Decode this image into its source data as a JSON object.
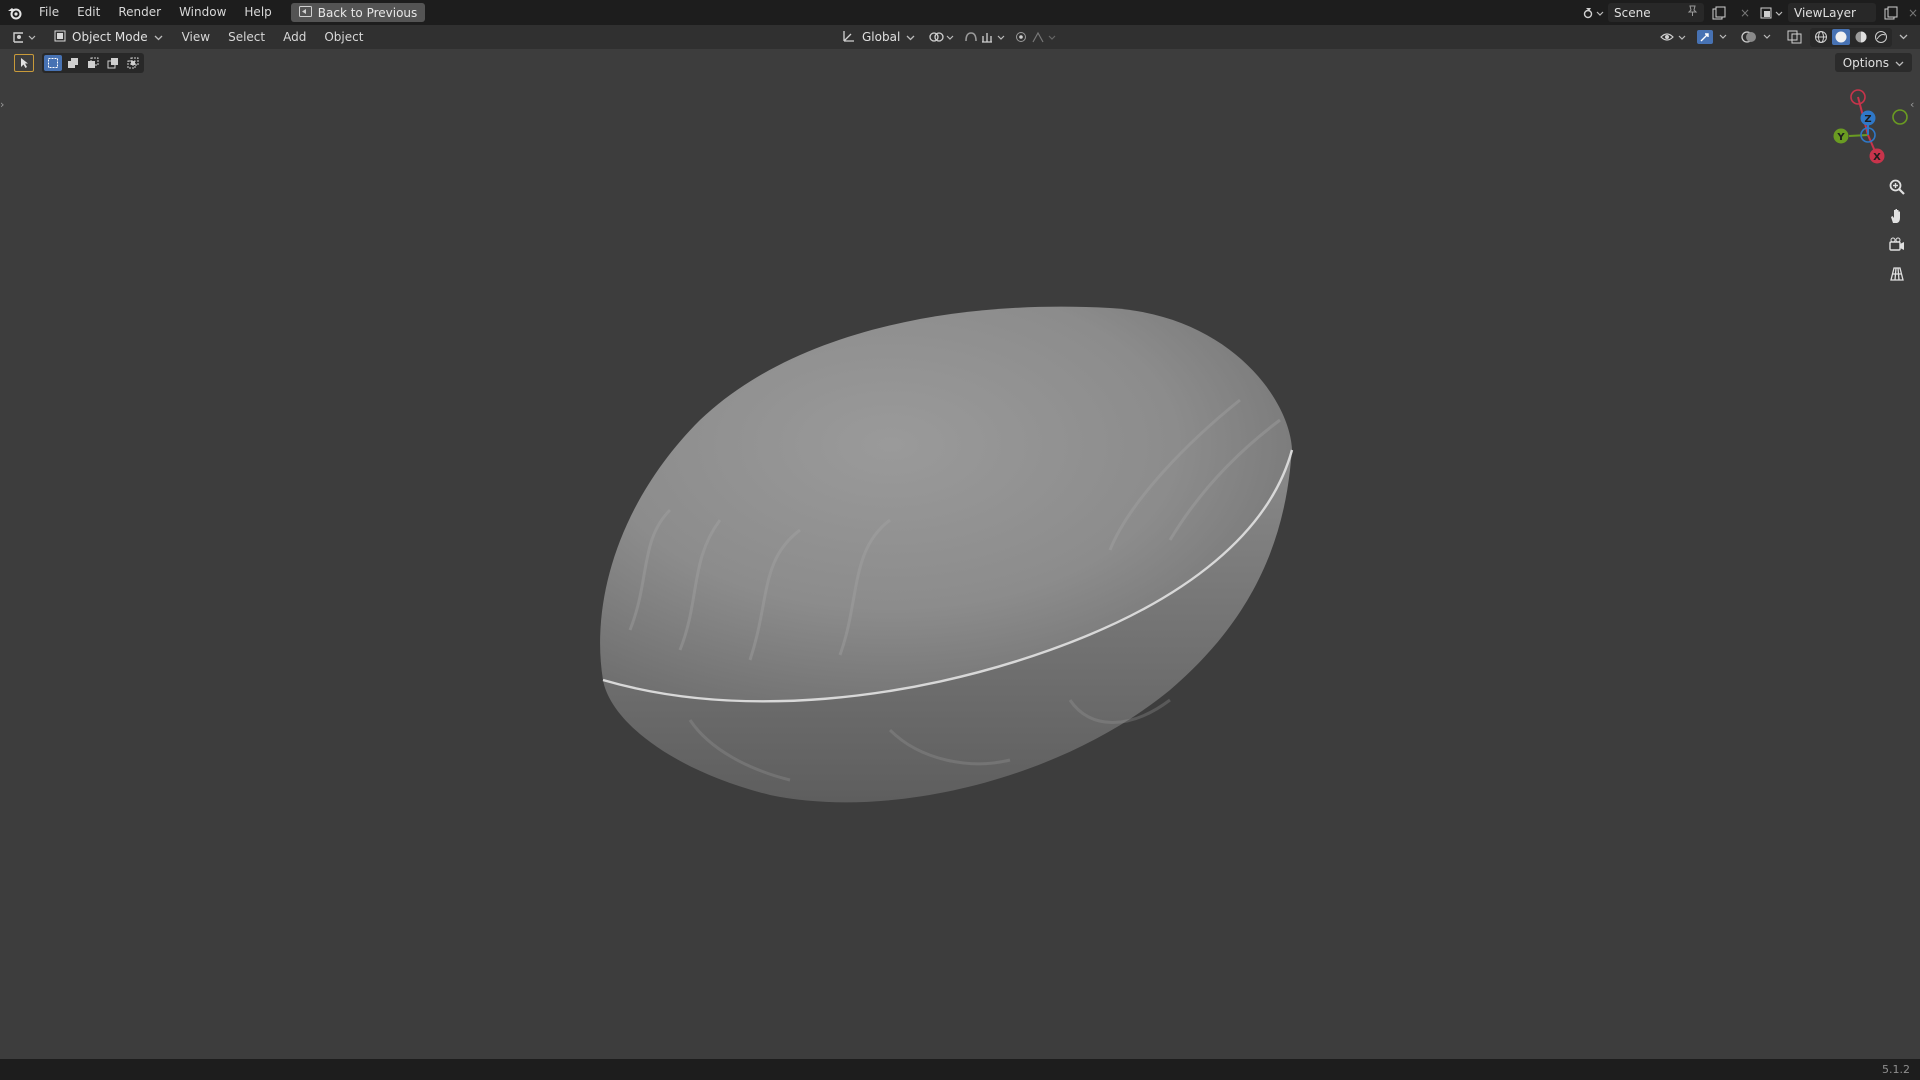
{
  "topbar": {
    "menus": [
      "File",
      "Edit",
      "Render",
      "Window",
      "Help"
    ],
    "back_button_label": "Back to Previous",
    "scene_name": "Scene",
    "view_layer_name": "ViewLayer"
  },
  "header": {
    "mode_label": "Object Mode",
    "menus": [
      "View",
      "Select",
      "Add",
      "Object"
    ],
    "transform_orientation": "Global"
  },
  "options_label": "Options",
  "gizmo": {
    "x": "X",
    "y": "Y",
    "z": "Z"
  },
  "status": {
    "version": "5.1.2"
  },
  "colors": {
    "x_axis": "#c8344b",
    "y_axis": "#6a9b22",
    "z_axis": "#2f78c8",
    "active_tool": "#4772b3"
  },
  "icons": [
    "blender-logo-icon",
    "back-icon",
    "scene-icon",
    "pin-icon",
    "new-scene-icon",
    "view-layer-icon",
    "editor-type-icon",
    "object-mode-icon",
    "orientation-icon",
    "pivot-icon",
    "snap-icon",
    "proportional-edit-icon",
    "visibility-icon",
    "gizmo-icon",
    "overlay-icon",
    "xray-icon",
    "wireframe-shading-icon",
    "solid-shading-icon",
    "material-shading-icon",
    "rendered-shading-icon",
    "zoom-icon",
    "pan-hand-icon",
    "camera-view-icon",
    "grid-ortho-icon"
  ]
}
